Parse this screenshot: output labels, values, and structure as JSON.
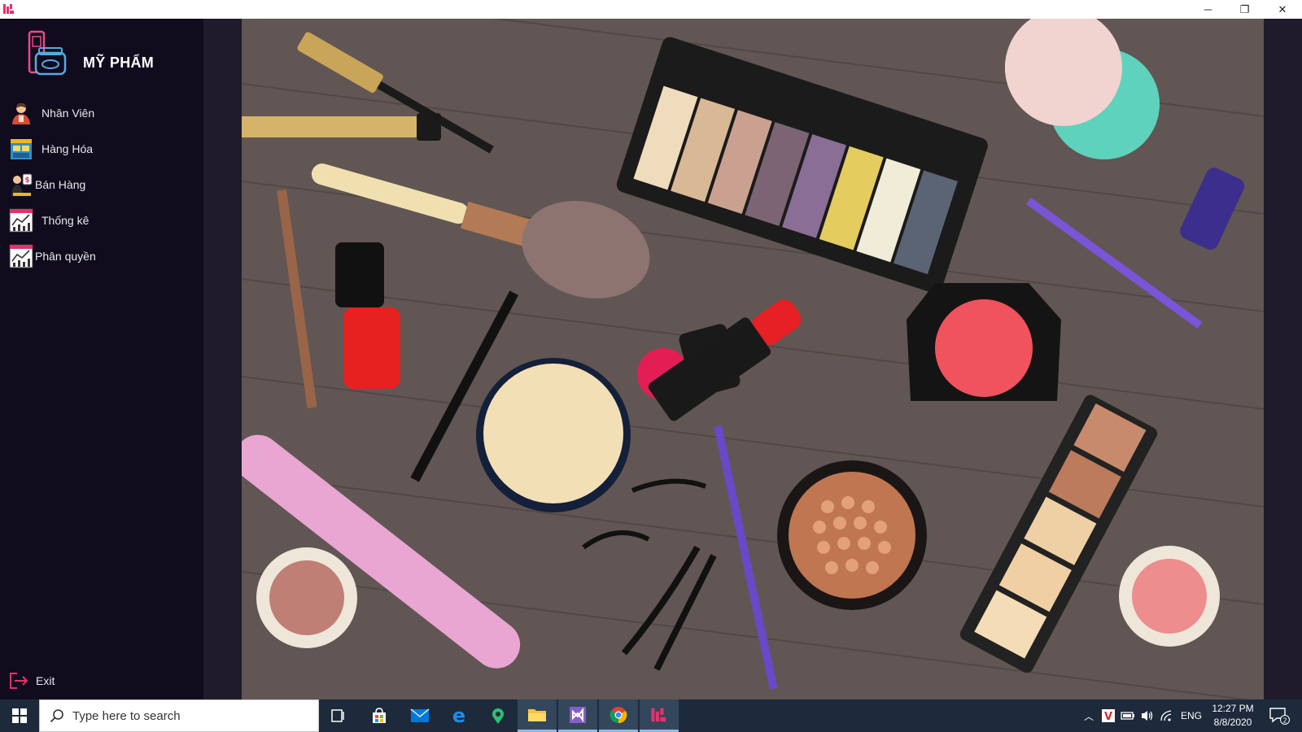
{
  "window": {
    "minimize_glyph": "─",
    "maximize_glyph": "❐",
    "close_glyph": "✕"
  },
  "brand": {
    "title": "MỸ PHẨM"
  },
  "sidebar": {
    "items": [
      {
        "label": "Nhân Viên",
        "icon": "employee-icon"
      },
      {
        "label": "Hàng Hóa",
        "icon": "goods-icon"
      },
      {
        "label": "Bán Hàng",
        "icon": "sales-icon"
      },
      {
        "label": "Thống kê",
        "icon": "statistics-icon"
      },
      {
        "label": "Phân quyền",
        "icon": "permission-icon"
      }
    ],
    "exit_label": "Exit"
  },
  "hero": {
    "subject": "cosmetics-flatlay-image"
  },
  "taskbar": {
    "search_placeholder": "Type here to search",
    "language": "ENG",
    "time": "12:27 PM",
    "date": "8/8/2020",
    "notification_count": "2"
  },
  "colors": {
    "sidebar_bg": "#110c1d",
    "content_bg": "#1f1b2a",
    "taskbar_bg": "#1c2a3b",
    "accent_pink": "#e0336b"
  }
}
